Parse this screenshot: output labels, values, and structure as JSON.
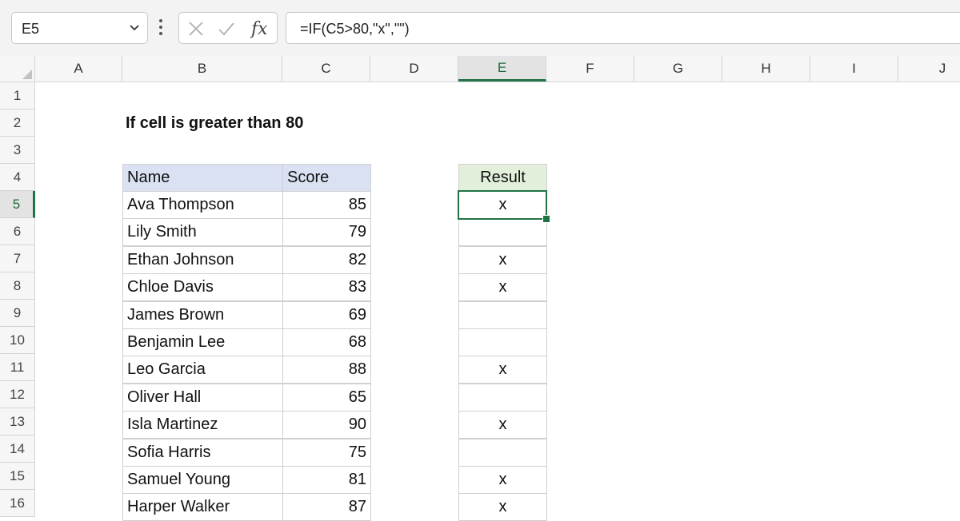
{
  "formula_bar": {
    "name_box": "E5",
    "formula": "=IF(C5>80,\"x\",\"\")"
  },
  "columns": [
    "A",
    "B",
    "C",
    "D",
    "E",
    "F",
    "G",
    "H",
    "I",
    "J"
  ],
  "active_column": "E",
  "rows": [
    "1",
    "2",
    "3",
    "4",
    "5",
    "6",
    "7",
    "8",
    "9",
    "10",
    "11",
    "12",
    "13",
    "14",
    "15",
    "16"
  ],
  "active_row": "5",
  "sheet": {
    "title": "If cell is greater than 80",
    "headers": {
      "name": "Name",
      "score": "Score",
      "result": "Result"
    },
    "records": [
      {
        "name": "Ava Thompson",
        "score": "85",
        "result": "x"
      },
      {
        "name": "Lily Smith",
        "score": "79",
        "result": ""
      },
      {
        "name": "Ethan Johnson",
        "score": "82",
        "result": "x"
      },
      {
        "name": "Chloe Davis",
        "score": "83",
        "result": "x"
      },
      {
        "name": "James Brown",
        "score": "69",
        "result": ""
      },
      {
        "name": "Benjamin Lee",
        "score": "68",
        "result": ""
      },
      {
        "name": "Leo Garcia",
        "score": "88",
        "result": "x"
      },
      {
        "name": "Oliver Hall",
        "score": "65",
        "result": ""
      },
      {
        "name": "Isla Martinez",
        "score": "90",
        "result": "x"
      },
      {
        "name": "Sofia Harris",
        "score": "75",
        "result": ""
      },
      {
        "name": "Samuel Young",
        "score": "81",
        "result": "x"
      },
      {
        "name": "Harper Walker",
        "score": "87",
        "result": "x"
      }
    ]
  },
  "colors": {
    "accent": "#217346",
    "table_header": "#d9e1f2",
    "result_header": "#e2efda"
  },
  "icons": {
    "dropdown": "chevron-down-icon",
    "more": "more-vertical-icon",
    "cancel": "cancel-icon",
    "enter": "check-icon",
    "function": "insert-function-icon"
  }
}
